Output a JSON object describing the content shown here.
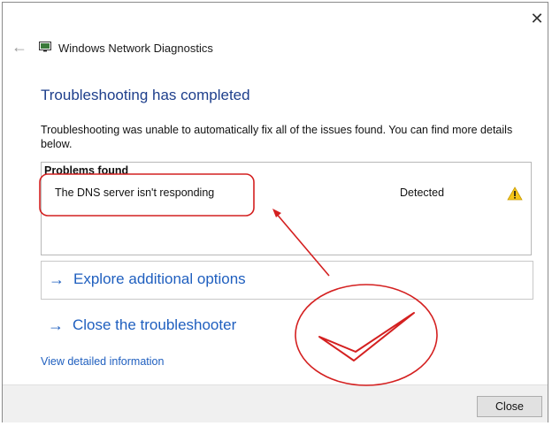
{
  "window": {
    "title": "Windows Network Diagnostics",
    "close_glyph": "✕",
    "back_glyph": "←"
  },
  "main": {
    "heading": "Troubleshooting has completed",
    "description": "Troubleshooting was unable to automatically fix all of the issues found. You can find more details below."
  },
  "problems": {
    "header": "Problems found",
    "items": [
      {
        "name": "The DNS server isn't responding",
        "status": "Detected",
        "icon": "warning-icon"
      }
    ]
  },
  "options": [
    {
      "arrow": "→",
      "label": "Explore additional options"
    },
    {
      "arrow": "→",
      "label": "Close the troubleshooter"
    }
  ],
  "links": {
    "view_detailed": "View detailed information"
  },
  "footer": {
    "close_label": "Close"
  },
  "colors": {
    "heading": "#1e3f8c",
    "link": "#1f5fbf",
    "annotation": "#d42020",
    "warning": "#f5c518"
  }
}
